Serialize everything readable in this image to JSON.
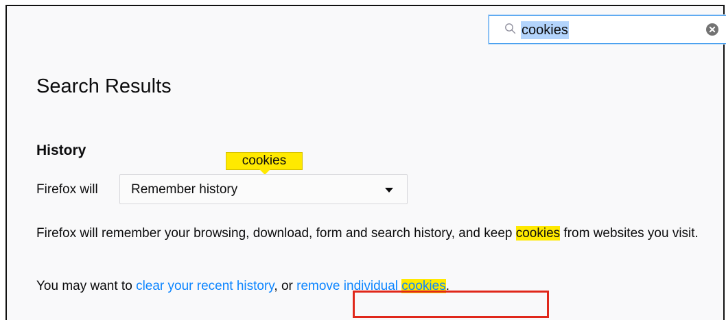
{
  "search": {
    "value": "cookies",
    "placeholder": ""
  },
  "page": {
    "title": "Search Results"
  },
  "history": {
    "heading": "History",
    "tooltip": "cookies",
    "firefox_will_label": "Firefox will",
    "select_value": "Remember history",
    "description_before": "Firefox will remember your browsing, download, form and search history, and keep ",
    "description_highlight": "cookies",
    "description_after": " from websites you visit.",
    "may_want_prefix": "You may want to ",
    "clear_history_link": "clear your recent history",
    "comma_or": ", or ",
    "remove_cookies_link_prefix": "remove individual ",
    "remove_cookies_link_highlight": "cookies",
    "trailing_period": "."
  },
  "colors": {
    "highlight": "#ffe900",
    "link": "#0a84ff",
    "annotation_box": "#e0271a",
    "selection": "#b3d4fc"
  }
}
